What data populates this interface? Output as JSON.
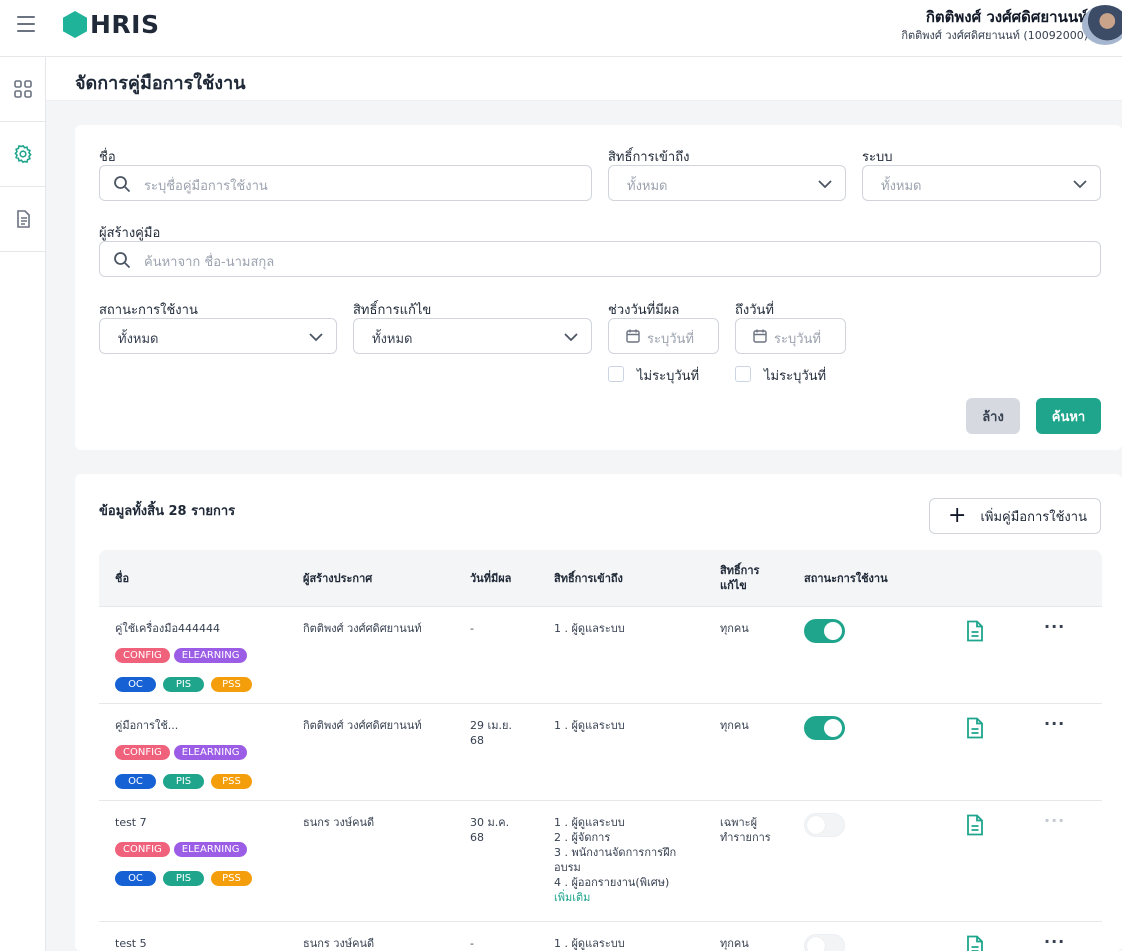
{
  "header": {
    "logo_text": "HRIS",
    "user_name": "กิตติพงศ์ วงศ์ศดิศยานนท์",
    "user_sub": "กิตติพงศ์ วงศ์ศดิศยานนท์ (10092000)"
  },
  "sidebar": {
    "items": [
      {
        "icon": "grid-icon"
      },
      {
        "icon": "gear-icon"
      },
      {
        "icon": "document-icon"
      }
    ]
  },
  "page": {
    "title": "จัดการคู่มือการใช้งาน"
  },
  "filters": {
    "name_label": "ชื่อ",
    "name_placeholder": "ระบุชื่อคู่มือการใช้งาน",
    "access_label": "สิทธิ์การเข้าถึง",
    "access_value": "ทั้งหมด",
    "system_label": "ระบบ",
    "system_value": "ทั้งหมด",
    "creator_label": "ผู้สร้างคู่มือ",
    "creator_placeholder": "ค้นหาจาก ชื่อ-นามสกุล",
    "status_label": "สถานะการใช้งาน",
    "status_value": "ทั้งหมด",
    "edit_label": "สิทธิ์การแก้ไข",
    "edit_value": "ทั้งหมด",
    "from_label": "ช่วงวันที่มีผล",
    "from_placeholder": "ระบุวันที่",
    "to_label": "ถึงวันที่",
    "to_placeholder": "ระบุวันที่",
    "no_date_from": "ไม่ระบุวันที่",
    "no_date_to": "ไม่ระบุวันที่",
    "clear_button": "ล้าง",
    "search_button": "ค้นหา"
  },
  "table": {
    "total_text": "ข้อมูลทั้งสิ้น 28 รายการ",
    "add_button": "เพิ่มคู่มือการใช้งาน",
    "headers": {
      "name": "ชื่อ",
      "creator": "ผู้สร้างประกาศ",
      "effective": "วันที่มีผล",
      "access": "สิทธิ์การเข้าถึง",
      "edit_line1": "สิทธิ์การ",
      "edit_line2": "แก้ไข",
      "status": "สถานะการใช้งาน"
    },
    "tag_labels": {
      "config": "CONFIG",
      "elearning": "ELEARNING",
      "oc": "OC",
      "pis": "PIS",
      "pss": "PSS"
    },
    "rows": [
      {
        "name": "คู่ใช้เครื่องมือ444444",
        "creator": "กิตติพงศ์ วงศ์ศดิศยานนท์",
        "date_line1": "-",
        "date_line2": "",
        "access": [
          "1 . ผู้ดูแลระบบ"
        ],
        "edit_line1": "ทุกคน",
        "edit_line2": "",
        "status_on": true
      },
      {
        "name": "คู่มือการใช้...",
        "creator": "กิตติพงศ์ วงศ์ศดิศยานนท์",
        "date_line1": "29 เม.ย.",
        "date_line2": "68",
        "access": [
          "1 . ผู้ดูแลระบบ"
        ],
        "edit_line1": "ทุกคน",
        "edit_line2": "",
        "status_on": true
      },
      {
        "name": "test 7",
        "creator": "ธนกร วงษ์คนดี",
        "date_line1": "30 ม.ค.",
        "date_line2": "68",
        "access": [
          "1 . ผู้ดูแลระบบ",
          "2 . ผู้จัดการ",
          "3 . พนักงานจัดการการฝึก",
          "อบรม",
          "4 . ผู้ออกรายงาน(พิเศษ)"
        ],
        "more": "เพิ่มเติม",
        "edit_line1": "เฉพาะผู้",
        "edit_line2": "ทำรายการ",
        "status_on": false
      },
      {
        "name": "test 5",
        "creator": "ธนกร วงษ์คนดี",
        "date_line1": "-",
        "date_line2": "",
        "access": [
          "1 . ผู้ดูแลระบบ"
        ],
        "edit_line1": "ทุกคน",
        "edit_line2": "",
        "status_on": false
      }
    ]
  },
  "colors": {
    "accent": "#1fa58c",
    "config": "#f0617c",
    "elearning": "#9b5de5",
    "oc": "#1662d4",
    "pss": "#f59e0b"
  }
}
